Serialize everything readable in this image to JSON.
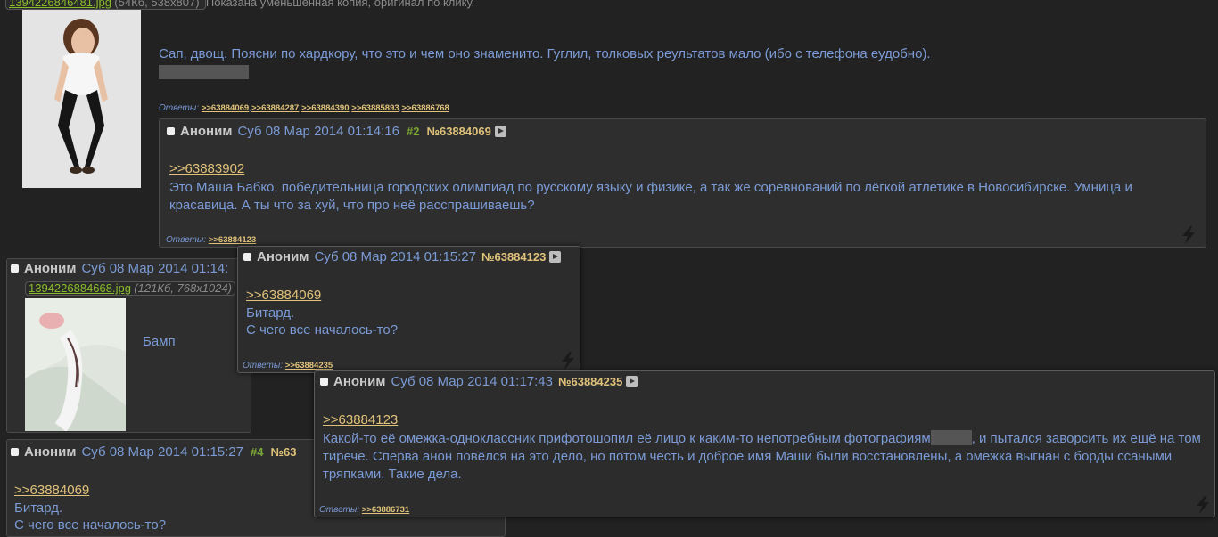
{
  "op": {
    "file_name": "1394226846481.jpg",
    "file_info": "(54Кб, 538x807)",
    "thumb_note": "Показана уменьшенная копия, оригинал по клику.",
    "text": "Сап, двощ. Поясни по хардкору, что это и чем оно знаменито. Гуглил, толковых реультатов мало (ибо с телефона еудобно).",
    "answers_label": "Ответы:",
    "answers": [
      ">>63884069",
      ">>63884287",
      ">>63884390",
      ">>63885893",
      ">>63886768"
    ]
  },
  "post2": {
    "name": "Аноним",
    "date": "Суб 08 Мар 2014 01:14:16",
    "num": "#2",
    "id": "№63884069",
    "ref": ">>63883902",
    "text": "Это Маша Бабко, победительница городских олимпиад по русскому языку и физике, а так же соревнований по лёгкой атлетике в Новосибирске. Умница и красавица. А ты что за хуй, что про неё расспрашиваешь?",
    "answers_label": "Ответы:",
    "answers": [
      ">>63884123"
    ]
  },
  "post3": {
    "name": "Аноним",
    "date": "Суб 08 Мар 2014 01:14:",
    "file_name": "1394226884668.jpg",
    "file_info": "(121Кб, 768x1024)",
    "text": "Бамп"
  },
  "post4": {
    "name": "Аноним",
    "date": "Суб 08 Мар 2014 01:15:27",
    "num": "#4",
    "id": "№63",
    "ref": ">>63884069",
    "line1": "Битард.",
    "line2": "С чего все началось-то?"
  },
  "popup1": {
    "name": "Аноним",
    "date": "Суб 08 Мар 2014 01:15:27",
    "id": "№63884123",
    "ref": ">>63884069",
    "line1": "Битард.",
    "line2": "С чего все началось-то?",
    "answers_label": "Ответы:",
    "answers": [
      ">>63884235"
    ]
  },
  "popup2": {
    "name": "Аноним",
    "date": "Суб 08 Мар 2014 01:17:43",
    "id": "№63884235",
    "ref": ">>63884123",
    "text_a": "Какой-то её омежка-одноклассник прифотошопил её лицо к каким-то непотребным фотографиям",
    "text_b": ", и пытался заворсить их ещё на том тирече. Сперва анон повёлся на это дело, но потом честь и доброе имя Маши были восстановлены, а омежка выгнан с борды ссаными тряпками. Такие дела.",
    "answers_label": "Ответы:",
    "answers": [
      ">>63886731"
    ]
  },
  "colors": {
    "background": "#222222",
    "text": "#7b9bd6",
    "reply_link": "#e0c27a",
    "file_link": "#8abd2b",
    "post_bg": "#2e2e2e"
  }
}
